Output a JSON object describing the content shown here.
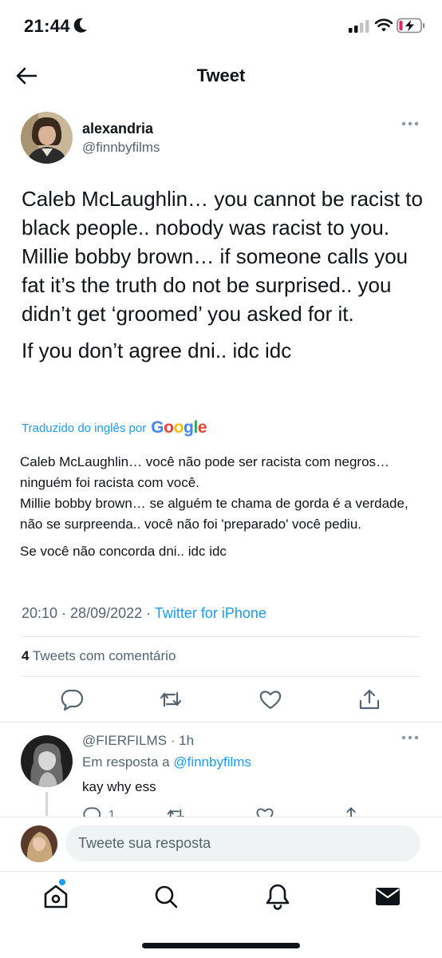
{
  "status_bar": {
    "time": "21:44",
    "icons": [
      "moon-icon",
      "cellular-signal-icon",
      "wifi-icon",
      "battery-low-charging-icon"
    ]
  },
  "header": {
    "title": "Tweet",
    "back_icon": "back-arrow-icon"
  },
  "tweet": {
    "author_name": "alexandria",
    "author_handle": "@finnbyfilms",
    "text_para1": "Caleb McLaughlin… you cannot be racist to black people.. nobody was racist to you.\nMillie bobby brown… if someone calls you fat it’s the truth do not be surprised.. you didn’t get ‘groomed’ you asked for it.",
    "text_para2": "If you don’t agree dni.. idc idc",
    "translated_by": "Traduzido do inglês por",
    "translator": "Google",
    "translation_para1": "Caleb McLaughlin… você não pode ser racista com negros… ninguém foi racista com você.\nMillie bobby brown… se alguém te chama de gorda é a verdade, não se surpreenda.. você não foi 'preparado' você pediu.",
    "translation_para2": "Se você não concorda dni.. idc idc",
    "time": "20:10",
    "date": "28/09/2022",
    "source": "Twitter for iPhone",
    "quote_count": "4",
    "quote_label": "Tweets com comentário"
  },
  "reply": {
    "handle": "@FIERFILMS",
    "time_ago": "1h",
    "replying_to_label": "Em resposta a",
    "replying_to_handle": "@finnbyfilms",
    "text": "kay why ess",
    "reply_count": "1"
  },
  "compose": {
    "placeholder": "Tweete sua resposta"
  },
  "tab_bar": {
    "items": [
      "home-icon",
      "search-icon",
      "notifications-bell-icon",
      "messages-envelope-icon"
    ]
  },
  "colors": {
    "accent": "#1d9bf0",
    "secondary_text": "#536471",
    "primary_text": "#0f1419",
    "divider": "#e1e6ea",
    "battery_low": "#e0245e"
  }
}
